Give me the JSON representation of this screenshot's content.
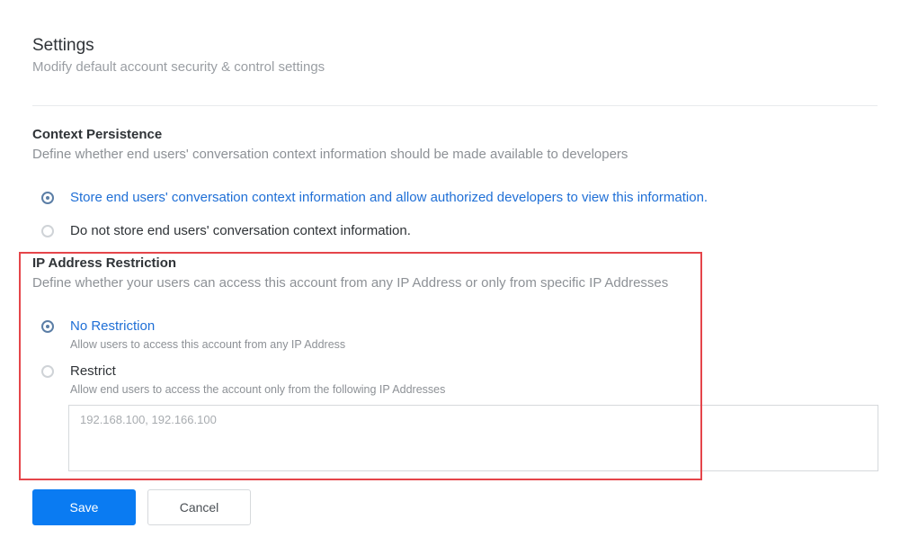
{
  "header": {
    "title": "Settings",
    "subtitle": "Modify default account security & control settings"
  },
  "context_persistence": {
    "title": "Context Persistence",
    "description": "Define whether end users' conversation context information should be made available to developers",
    "options": [
      {
        "label": "Store end users' conversation context information and allow authorized developers to view this information.",
        "selected": true
      },
      {
        "label": "Do not store end users' conversation context information.",
        "selected": false
      }
    ]
  },
  "ip_restriction": {
    "title": "IP Address Restriction",
    "description": "Define whether your users can access this account from any IP Address or only from specific IP Addresses",
    "options": [
      {
        "label": "No Restriction",
        "hint": "Allow users to access this account from any IP Address",
        "selected": true
      },
      {
        "label": "Restrict",
        "hint": "Allow end users to access the account only from the following IP Addresses",
        "selected": false
      }
    ],
    "ip_input": {
      "value": "",
      "placeholder": "192.168.100, 192.166.100"
    }
  },
  "actions": {
    "save_label": "Save",
    "cancel_label": "Cancel"
  },
  "colors": {
    "accent": "#0a7bf2",
    "selected_text": "#1f6fd6",
    "highlight_border": "#e5454a"
  }
}
